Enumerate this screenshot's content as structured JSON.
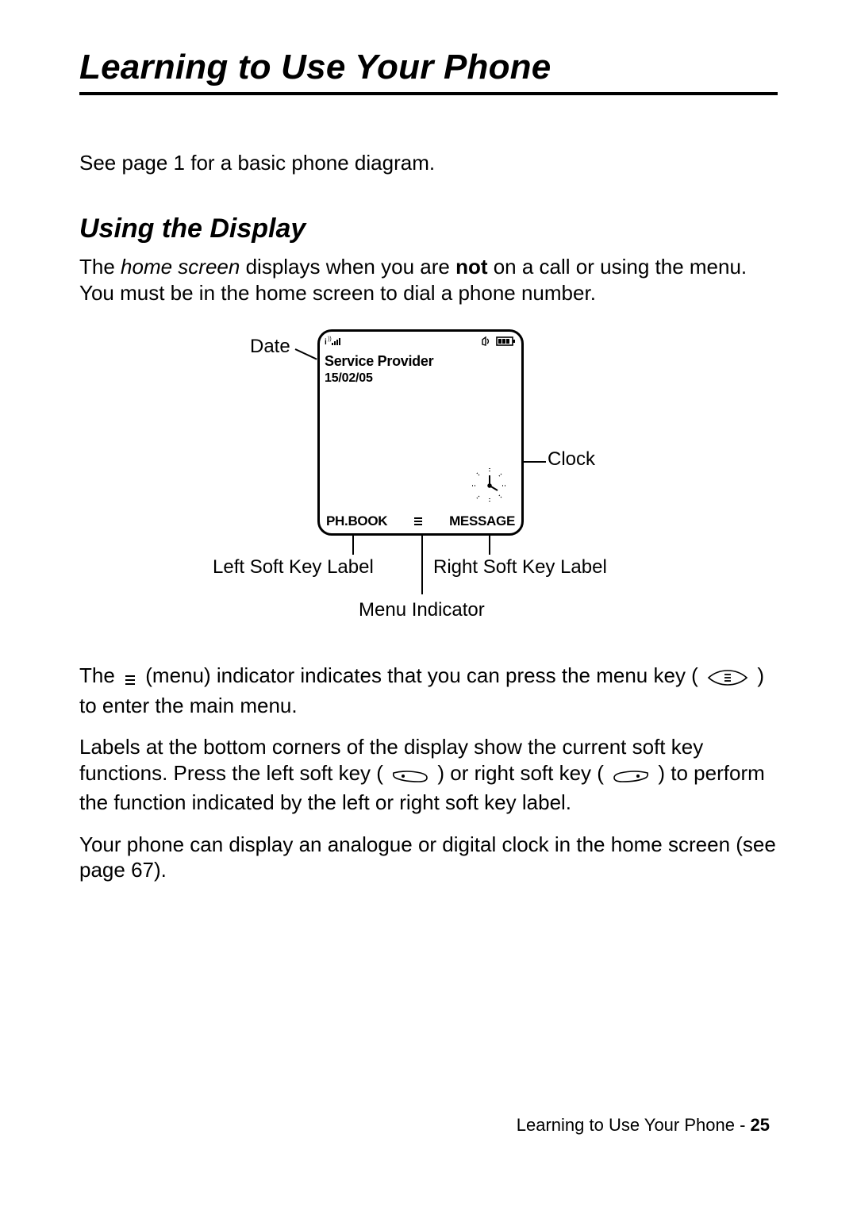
{
  "chapter_title": "Learning to Use Your Phone",
  "intro_text": "See page 1 for a basic phone diagram.",
  "section_title": "Using the Display",
  "para1_a": "The ",
  "para1_term": "home screen",
  "para1_b": " displays when you are ",
  "para1_kw": "not",
  "para1_c": " on a call or using the menu. You must be in the home screen to dial a phone number.",
  "diagram": {
    "date_label": "Date",
    "clock_label": "Clock",
    "left_soft_label": "Left Soft Key Label",
    "right_soft_label": "Right Soft Key Label",
    "menu_indicator_label": "Menu Indicator"
  },
  "phone": {
    "service_provider": "Service Provider",
    "date": "15/02/05",
    "left_soft": "PH.BOOK",
    "right_soft": "MESSAGE"
  },
  "para2_a": "The ",
  "para2_b": " (menu) indicator indicates that you can press the menu key (",
  "para2_c": ") to enter the main menu.",
  "para3_a": "Labels at the bottom corners of the display show the current soft key functions. Press the left soft key (",
  "para3_b": ") or right soft key (",
  "para3_c": ") to perform the function indicated by the left or right soft key label.",
  "para4": "Your phone can display an analogue or digital clock in the home screen (see page 67).",
  "footer_text": "Learning to Use Your Phone - ",
  "footer_page": "25",
  "icons": {
    "signal": "signal-icon",
    "ring": "ring-icon",
    "battery": "battery-icon",
    "gprs": "gprs-signal-icon",
    "clock_face": "clock-face-icon",
    "menu": "menu-indicator-icon",
    "menu_key": "menu-key-icon",
    "left_key": "left-soft-key-icon",
    "right_key": "right-soft-key-icon"
  }
}
